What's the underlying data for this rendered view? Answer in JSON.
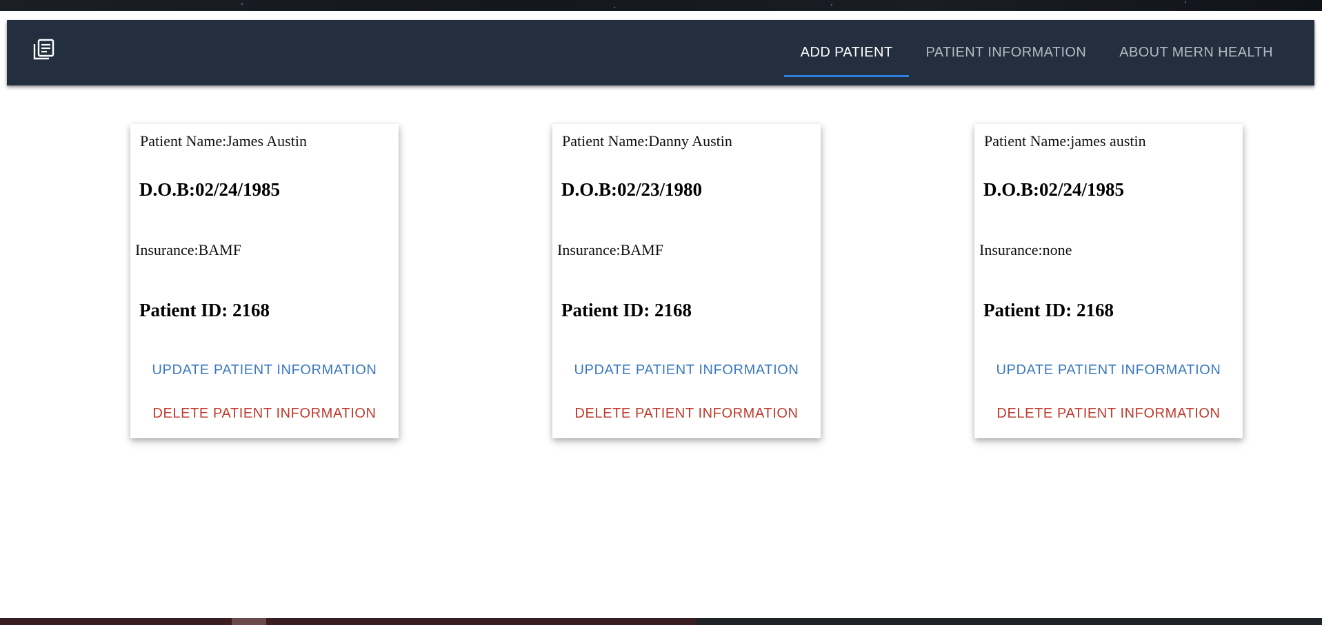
{
  "navbar": {
    "menu_icon": "library-books-icon",
    "tabs": [
      {
        "label": "ADD PATIENT",
        "active": true
      },
      {
        "label": "PATIENT INFORMATION",
        "active": false
      },
      {
        "label": "ABOUT MERN HEALTH",
        "active": false
      }
    ]
  },
  "patients": [
    {
      "name": "Patient Name:James Austin",
      "dob": "D.O.B:02/24/1985",
      "insurance": "Insurance:BAMF",
      "patient_id": "Patient ID: 2168",
      "update_label": "UPDATE PATIENT INFORMATION",
      "delete_label": "DELETE PATIENT INFORMATION"
    },
    {
      "name": "Patient Name:Danny Austin",
      "dob": "D.O.B:02/23/1980",
      "insurance": "Insurance:BAMF",
      "patient_id": "Patient ID: 2168",
      "update_label": "UPDATE PATIENT INFORMATION",
      "delete_label": "DELETE PATIENT INFORMATION"
    },
    {
      "name": "Patient Name:james austin",
      "dob": "D.O.B:02/24/1985",
      "insurance": "Insurance:none",
      "patient_id": "Patient ID: 2168",
      "update_label": "UPDATE PATIENT INFORMATION",
      "delete_label": "DELETE PATIENT INFORMATION"
    }
  ],
  "colors": {
    "appbar": "#232f3e",
    "tab_indicator": "#2f7ee0",
    "update_button": "#3a78c3",
    "delete_button": "#c0392b"
  }
}
